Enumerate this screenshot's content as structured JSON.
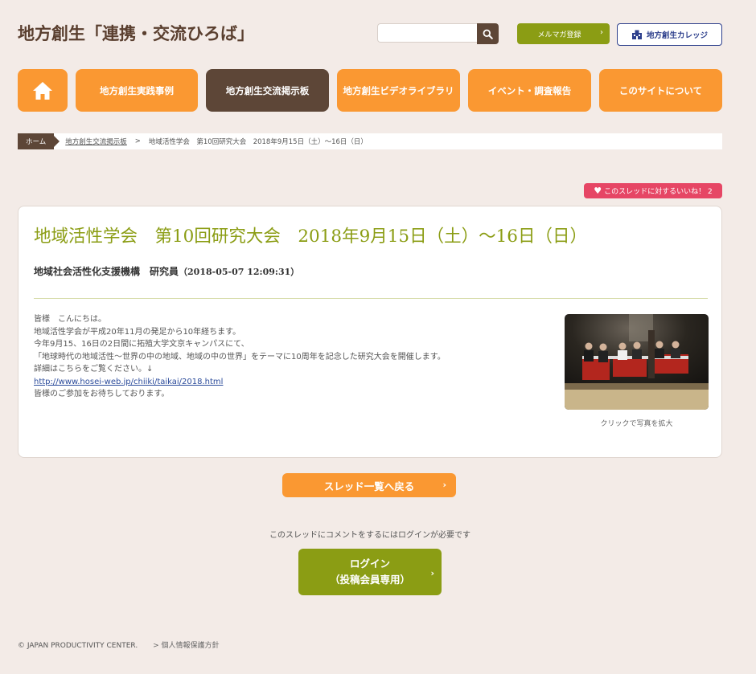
{
  "header": {
    "site_title": "地方創生「連携・交流ひろば」",
    "search": {
      "placeholder": "",
      "value": ""
    },
    "magazine_btn": "メルマガ登録",
    "college_btn": "地方創生カレッジ"
  },
  "nav": {
    "items": [
      {
        "label": "地方創生実践事例"
      },
      {
        "label": "地方創生交流掲示板"
      },
      {
        "label": "地方創生ビデオライブラリ"
      },
      {
        "label": "イベント・調査報告"
      },
      {
        "label": "このサイトについて"
      }
    ]
  },
  "breadcrumb": {
    "home": "ホーム",
    "link": "地方創生交流掲示板",
    "separator": ">",
    "current": "地域活性学会　第10回研究大会　2018年9月15日（土）～16日（日）"
  },
  "like_badge": "このスレッドに対するいいね！ 2",
  "post": {
    "title": "地域活性学会　第10回研究大会　2018年9月15日（土）～16日（日）",
    "author": "地域社会活性化支援機構　研究員",
    "date": "（2018-05-07 12:09:31）",
    "body": [
      "皆様　こんにちは。",
      "地域活性学会が平成20年11月の発足から10年経ちます。",
      "今年9月15、16日の2日間に拓殖大学文京キャンパスにて、",
      "「地球時代の地域活性～世界の中の地域、地域の中の世界」をテーマに10周年を記念した研究大会を開催します。",
      "詳細はこちらをご覧ください。↓"
    ],
    "link": "http://www.hosei-web.jp/chiiki/taikai/2018.html",
    "closing": "皆様のご参加をお待ちしております。",
    "photo_caption": "クリックで写真を拡大"
  },
  "back_btn": "スレッド一覧へ戻る",
  "login_notice": "このスレッドにコメントをするにはログインが必要です",
  "login_btn": {
    "line1": "ログイン",
    "line2": "（投稿会員専用）"
  },
  "footer": {
    "copyright": "© JAPAN PRODUCTIVITY CENTER.",
    "privacy": "> 個人情報保護方針"
  },
  "colors": {
    "orange": "#fa9832",
    "brown": "#5d4637",
    "olive": "#8b9d14",
    "pink": "#e64665",
    "navy": "#2d3f8c",
    "background": "#f3ebe7"
  },
  "icons": [
    "home-icon",
    "search-icon",
    "chevron-right-icon",
    "building-icon",
    "heart-icon"
  ]
}
